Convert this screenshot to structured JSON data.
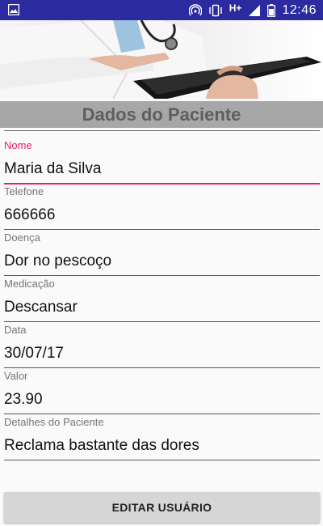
{
  "status_bar": {
    "time": "12:46",
    "network": "H+",
    "icons": [
      "image-icon",
      "hotspot-icon",
      "vibrate-icon",
      "signal-icon",
      "battery-icon"
    ]
  },
  "header": {
    "image": "doctor-tablet-image"
  },
  "form": {
    "title": "Dados do Paciente",
    "fields": [
      {
        "label": "Nome",
        "value": "Maria da Silva",
        "focused": true
      },
      {
        "label": "Telefone",
        "value": "666666"
      },
      {
        "label": "Doença",
        "value": "Dor no pescoço"
      },
      {
        "label": "Medicação",
        "value": "Descansar"
      },
      {
        "label": "Data",
        "value": "30/07/17"
      },
      {
        "label": "Valor",
        "value": "23.90"
      },
      {
        "label": "Detalhes do Paciente",
        "value": "Reclama bastante das dores"
      }
    ]
  },
  "actions": {
    "edit_label": "EDITAR USUÁRIO"
  },
  "colors": {
    "status_bar": "#2b2a9e",
    "accent": "#e91e63",
    "title_band": "#a7a7a7",
    "title_text": "#5e5e5e"
  }
}
